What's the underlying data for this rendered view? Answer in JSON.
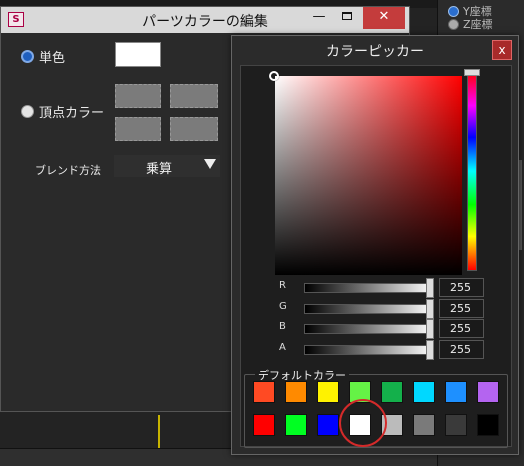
{
  "app": {
    "right_panel": {
      "items": [
        "Y座標",
        "Z座標"
      ]
    }
  },
  "editor": {
    "window_title": "パーツカラーの編集",
    "app_icon_letter": "S",
    "controls": {
      "minimize": "—",
      "close": "✕"
    },
    "single_color_label": "単色",
    "vertex_color_label": "頂点カラー",
    "blend_label": "ブレンド方法",
    "blend_value": "乗算"
  },
  "picker": {
    "window_title": "カラーピッカー",
    "close": "x",
    "sv_hue_color": "#ff0000",
    "channels": [
      {
        "name": "R",
        "value": "255"
      },
      {
        "name": "G",
        "value": "255"
      },
      {
        "name": "B",
        "value": "255"
      },
      {
        "name": "A",
        "value": "255"
      }
    ],
    "defaults_label": "デフォルトカラー",
    "default_colors_row1": [
      "#ff4a23",
      "#ff8a00",
      "#fff200",
      "#65f246",
      "#14b04b",
      "#00d8ff",
      "#1e90ff",
      "#b464f0"
    ],
    "default_colors_row2": [
      "#ff0000",
      "#00ff22",
      "#0000ff",
      "#ffffff",
      "#bbbbbb",
      "#7a7a7a",
      "#3a3a3a",
      "#000000"
    ]
  }
}
